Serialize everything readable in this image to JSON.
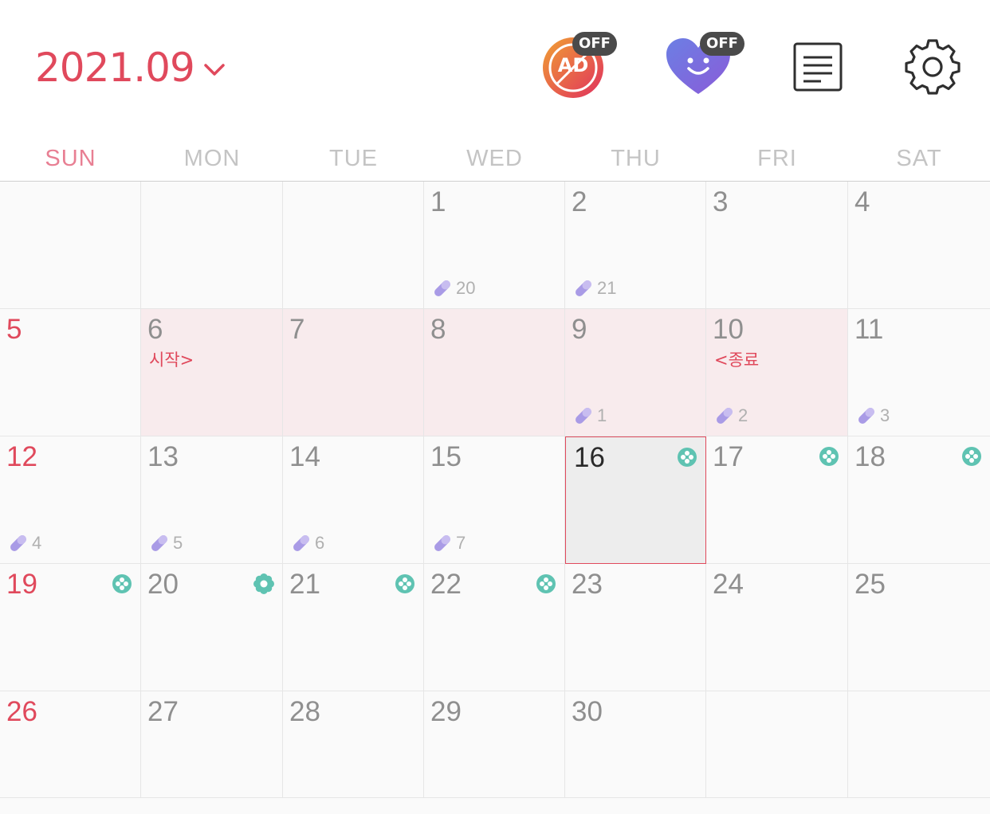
{
  "header": {
    "month_title": "2021.09",
    "ad_label": "AD",
    "ad_badge": "OFF",
    "mood_badge": "OFF"
  },
  "colors": {
    "accent": "#e0495c",
    "period_bg": "#f8ebed",
    "pill": "#a99be6",
    "flower": "#5fc3b2",
    "heart": "#7b6ae0"
  },
  "weekdays": [
    "SUN",
    "MON",
    "TUE",
    "WED",
    "THU",
    "FRI",
    "SAT"
  ],
  "calendar": {
    "cells": [
      {
        "day": "",
        "note": "",
        "pill": "",
        "flower": "",
        "period": false,
        "today": false
      },
      {
        "day": "",
        "note": "",
        "pill": "",
        "flower": "",
        "period": false,
        "today": false
      },
      {
        "day": "",
        "note": "",
        "pill": "",
        "flower": "",
        "period": false,
        "today": false
      },
      {
        "day": "1",
        "note": "",
        "pill": "20",
        "flower": "",
        "period": false,
        "today": false
      },
      {
        "day": "2",
        "note": "",
        "pill": "21",
        "flower": "",
        "period": false,
        "today": false
      },
      {
        "day": "3",
        "note": "",
        "pill": "",
        "flower": "",
        "period": false,
        "today": false
      },
      {
        "day": "4",
        "note": "",
        "pill": "",
        "flower": "",
        "period": false,
        "today": false
      },
      {
        "day": "5",
        "note": "",
        "pill": "",
        "flower": "",
        "period": false,
        "today": false
      },
      {
        "day": "6",
        "note": "시작>",
        "pill": "",
        "flower": "",
        "period": true,
        "today": false
      },
      {
        "day": "7",
        "note": "",
        "pill": "",
        "flower": "",
        "period": true,
        "today": false
      },
      {
        "day": "8",
        "note": "",
        "pill": "",
        "flower": "",
        "period": true,
        "today": false
      },
      {
        "day": "9",
        "note": "",
        "pill": "1",
        "flower": "",
        "period": true,
        "today": false
      },
      {
        "day": "10",
        "note": "<종료",
        "pill": "2",
        "flower": "",
        "period": true,
        "today": false
      },
      {
        "day": "11",
        "note": "",
        "pill": "3",
        "flower": "",
        "period": false,
        "today": false
      },
      {
        "day": "12",
        "note": "",
        "pill": "4",
        "flower": "",
        "period": false,
        "today": false
      },
      {
        "day": "13",
        "note": "",
        "pill": "5",
        "flower": "",
        "period": false,
        "today": false
      },
      {
        "day": "14",
        "note": "",
        "pill": "6",
        "flower": "",
        "period": false,
        "today": false
      },
      {
        "day": "15",
        "note": "",
        "pill": "7",
        "flower": "",
        "period": false,
        "today": false
      },
      {
        "day": "16",
        "note": "",
        "pill": "",
        "flower": "fertile-icon",
        "period": false,
        "today": true
      },
      {
        "day": "17",
        "note": "",
        "pill": "",
        "flower": "fertile-icon",
        "period": false,
        "today": false
      },
      {
        "day": "18",
        "note": "",
        "pill": "",
        "flower": "fertile-icon",
        "period": false,
        "today": false
      },
      {
        "day": "19",
        "note": "",
        "pill": "",
        "flower": "fertile-icon",
        "period": false,
        "today": false
      },
      {
        "day": "20",
        "note": "",
        "pill": "",
        "flower": "ovulation-icon",
        "period": false,
        "today": false
      },
      {
        "day": "21",
        "note": "",
        "pill": "",
        "flower": "fertile-icon",
        "period": false,
        "today": false
      },
      {
        "day": "22",
        "note": "",
        "pill": "",
        "flower": "fertile-icon",
        "period": false,
        "today": false
      },
      {
        "day": "23",
        "note": "",
        "pill": "",
        "flower": "",
        "period": false,
        "today": false
      },
      {
        "day": "24",
        "note": "",
        "pill": "",
        "flower": "",
        "period": false,
        "today": false
      },
      {
        "day": "25",
        "note": "",
        "pill": "",
        "flower": "",
        "period": false,
        "today": false
      },
      {
        "day": "26",
        "note": "",
        "pill": "",
        "flower": "",
        "period": false,
        "today": false
      },
      {
        "day": "27",
        "note": "",
        "pill": "",
        "flower": "",
        "period": false,
        "today": false
      },
      {
        "day": "28",
        "note": "",
        "pill": "",
        "flower": "",
        "period": false,
        "today": false
      },
      {
        "day": "29",
        "note": "",
        "pill": "",
        "flower": "",
        "period": false,
        "today": false
      },
      {
        "day": "30",
        "note": "",
        "pill": "",
        "flower": "",
        "period": false,
        "today": false
      },
      {
        "day": "",
        "note": "",
        "pill": "",
        "flower": "",
        "period": false,
        "today": false
      },
      {
        "day": "",
        "note": "",
        "pill": "",
        "flower": "",
        "period": false,
        "today": false
      }
    ]
  }
}
